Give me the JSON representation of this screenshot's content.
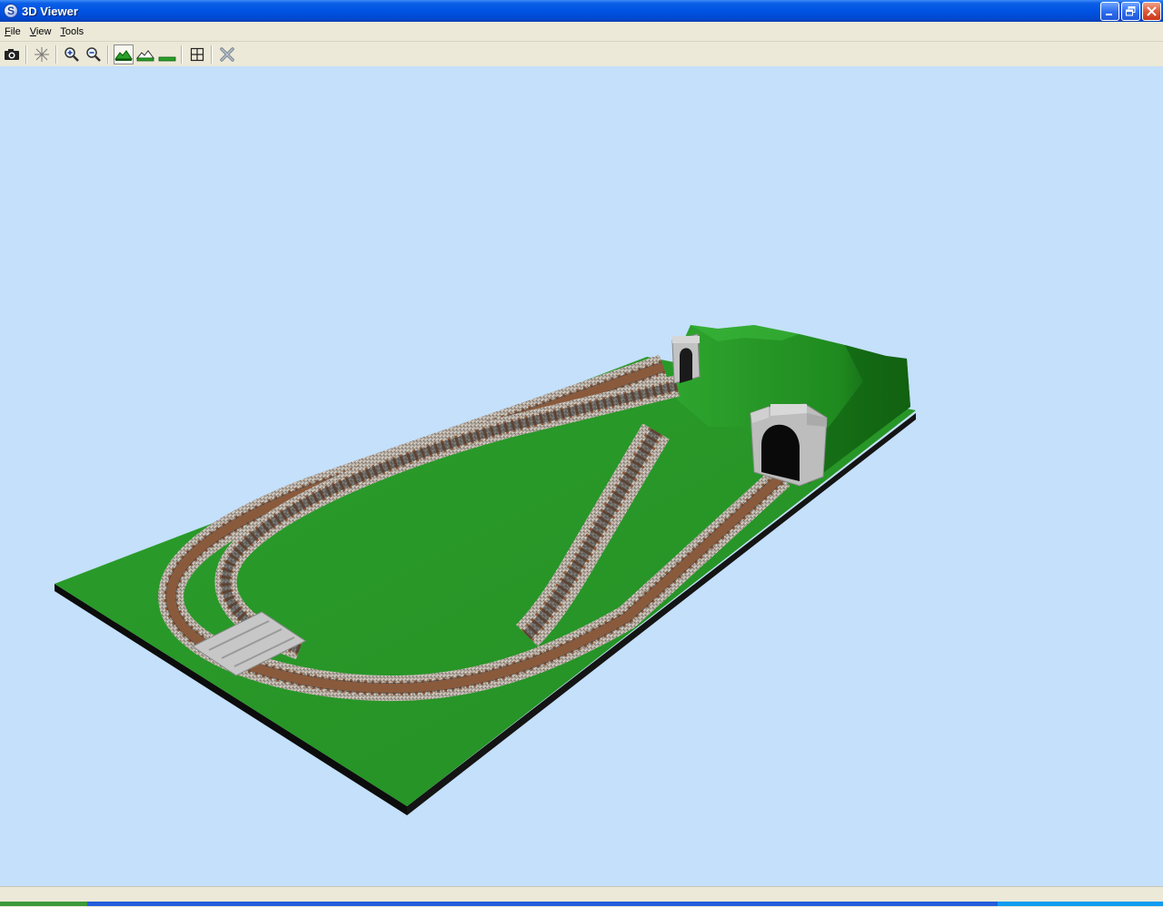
{
  "window": {
    "title": "3D Viewer",
    "app_icon_letter": "S"
  },
  "menu": {
    "items": [
      {
        "label": "File",
        "accel": "F",
        "rest": "ile"
      },
      {
        "label": "View",
        "accel": "V",
        "rest": "iew"
      },
      {
        "label": "Tools",
        "accel": "T",
        "rest": "ools"
      }
    ]
  },
  "toolbar": {
    "tools": [
      {
        "name": "camera-icon"
      },
      {
        "name": "center-view-icon"
      },
      {
        "name": "zoom-in-icon"
      },
      {
        "name": "zoom-out-icon"
      },
      {
        "name": "terrain-full-icon",
        "active": true
      },
      {
        "name": "terrain-outline-icon"
      },
      {
        "name": "terrain-flat-icon"
      },
      {
        "name": "grid-icon"
      },
      {
        "name": "close-x-icon"
      }
    ]
  },
  "colors": {
    "viewport_bg": "#c4e0fb",
    "grass": "#2a9a2a",
    "board_edge": "#0a0a0a",
    "ballast": "#b8b0a6",
    "sleepers": "#8a5a3c",
    "tunnel_portal": "#bdbdbd"
  }
}
